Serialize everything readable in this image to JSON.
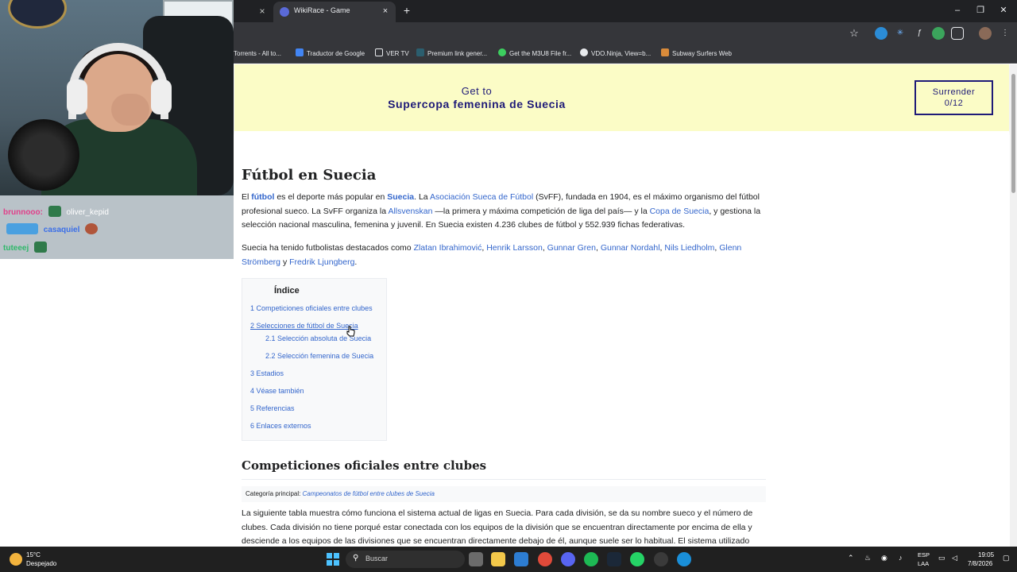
{
  "browser": {
    "active_tab_title": "WikiRace - Game",
    "prev_tab_close": "×",
    "tab_close": "×",
    "new_tab": "+",
    "window": {
      "minimize": "–",
      "restore": "❐",
      "close": "✕"
    },
    "bookmarks": [
      "Torrents - All to...",
      "Traductor de Google",
      "VER TV",
      "Premium link gener...",
      "Get the M3U8 File fr...",
      "VDO.Ninja, View=b...",
      "Subway Surfers Web"
    ]
  },
  "chat": {
    "lines": [
      {
        "user": "brunnooo:",
        "text": "oliver_kepid"
      },
      {
        "user": "",
        "text": "casaquiel"
      },
      {
        "user": "tuteeej",
        "text": ""
      }
    ]
  },
  "game": {
    "goal_label": "Get to",
    "goal_target": "Supercopa femenina de Suecia",
    "surrender_label": "Surrender",
    "surrender_count": "0/12"
  },
  "article": {
    "title": "Fútbol en Suecia",
    "p1": {
      "t1": "El ",
      "futbol": "fútbol",
      "t2": " es el deporte más popular en ",
      "suecia": "Suecia",
      "t3": ". La ",
      "asociacion": "Asociación Sueca de Fútbol",
      "t4": " (SvFF), fundada en 1904, es el máximo organismo del fútbol profesional sueco. La SvFF organiza la ",
      "allsvenskan": "Allsvenskan",
      "t5": " —la primera y máxima competición de liga del país— y la ",
      "copa": "Copa de Suecia",
      "t6": ", y gestiona la selección nacional masculina, femenina y juvenil. En Suecia existen 4.236 clubes de fútbol y 552.939 fichas federativas."
    },
    "p2": {
      "t1": "Suecia ha tenido futbolistas destacados como ",
      "zlatan": "Zlatan Ibrahimović",
      "c1": ", ",
      "larsson": "Henrik Larsson",
      "c2": ", ",
      "gren": "Gunnar Gren",
      "c3": ", ",
      "nordahl": "Gunnar Nordahl",
      "c4": ", ",
      "liedholm": "Nils Liedholm",
      "c5": ", ",
      "stromberg": "Glenn Strömberg",
      "t2": " y ",
      "ljungberg": "Fredrik Ljungberg",
      "t3": "."
    },
    "toc": {
      "title": "Índice",
      "items": [
        "1 Competiciones oficiales entre clubes",
        "2 Selecciones de fútbol de Suecia",
        "2.1 Selección absoluta de Suecia",
        "2.2 Selección femenina de Suecia",
        "3 Estadios",
        "4 Véase también",
        "5 Referencias",
        "6 Enlaces externos"
      ]
    },
    "section_title": "Competiciones oficiales entre clubes",
    "hatnote_label": "Categoría principal: ",
    "hatnote_link": "Campeonatos de fútbol entre clubes de Suecia",
    "p3": "La siguiente tabla muestra cómo funciona el sistema actual de ligas en Suecia. Para cada división, se da su nombre sueco y el número de clubes. Cada división no tiene porqué estar conectada con los equipos de la división que se encuentran directamente por encima de ella y desciende a los equipos de las divisiones que se encuentran directamente debajo de él, aunque suele ser lo habitual. El sistema utilizado"
  },
  "taskbar": {
    "temperature": "15°C",
    "condition": "Despejado",
    "search_placeholder": "Buscar",
    "lang_1": "ESP",
    "lang_2": "LAA",
    "time": "19:05",
    "date": "7/8/2026"
  },
  "colors": {
    "game_header_bg": "#fbfcc6",
    "game_accent": "#1e1a78",
    "link": "#3366cc"
  }
}
